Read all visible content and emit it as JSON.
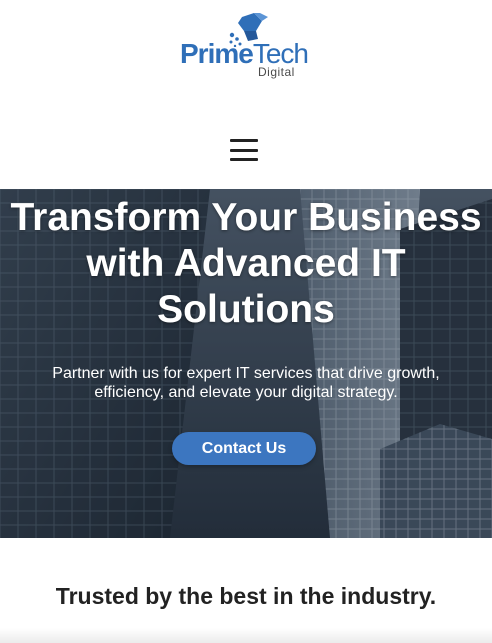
{
  "header": {
    "logo_primary": "Prime",
    "logo_secondary": "Tech",
    "logo_subtitle": "Digital",
    "logo_mark_icon": "cube-network-icon",
    "menu_icon": "hamburger-menu-icon"
  },
  "hero": {
    "title": "Transform Your Business with Advanced IT Solutions",
    "subtitle": "Partner with us for expert IT services that drive growth, efficiency, and elevate your digital strategy.",
    "cta_label": "Contact Us"
  },
  "trusted": {
    "heading": "Trusted by the best in the industry."
  },
  "colors": {
    "brand_blue": "#2f6fb8",
    "cta_blue": "#3c76c0",
    "hero_text": "#ffffff"
  }
}
